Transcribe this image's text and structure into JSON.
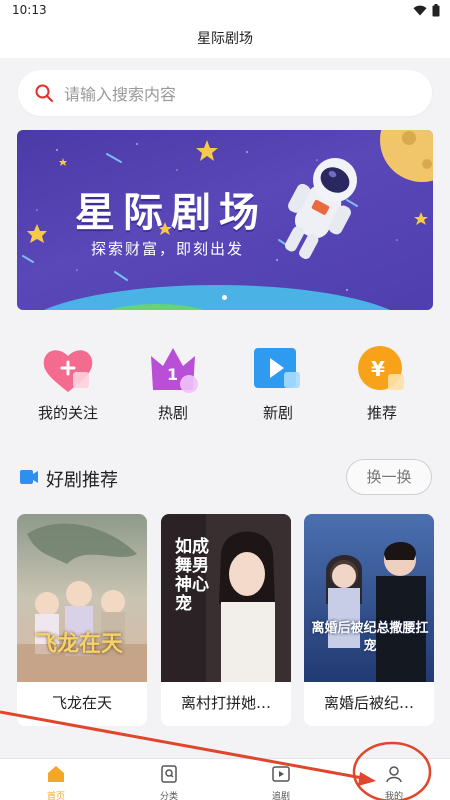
{
  "status_bar": {
    "time": "10:13"
  },
  "header": {
    "title": "星际剧场"
  },
  "search": {
    "placeholder": "请输入搜索内容"
  },
  "banner": {
    "title": "星际剧场",
    "subtitle": "探索财富，即刻出发",
    "colors": {
      "background": "#4f3fae",
      "star": "#f7c948"
    }
  },
  "quick_actions": [
    {
      "label": "我的关注",
      "icon": "heart-plus-icon"
    },
    {
      "label": "热剧",
      "icon": "crown-one-icon"
    },
    {
      "label": "新剧",
      "icon": "play-icon"
    },
    {
      "label": "推荐",
      "icon": "yen-coin-icon"
    }
  ],
  "recommend": {
    "title": "好剧推荐",
    "refresh_label": "换一换",
    "items": [
      {
        "title": "飞龙在天",
        "cover_text": "飞龙在天"
      },
      {
        "title": "离村打拼她…",
        "cover_text": "如成舞男神心宠"
      },
      {
        "title": "离婚后被纪…",
        "cover_text": "离婚后被纪总撒腰扛宠"
      }
    ]
  },
  "bottom_nav": [
    {
      "label": "首页",
      "icon": "home-icon",
      "active": true
    },
    {
      "label": "分类",
      "icon": "category-icon",
      "active": false
    },
    {
      "label": "追剧",
      "icon": "video-icon",
      "active": false
    },
    {
      "label": "我的",
      "icon": "user-icon",
      "active": false
    }
  ],
  "colors": {
    "accent": "#f5a623",
    "annotation": "#e0462b"
  }
}
